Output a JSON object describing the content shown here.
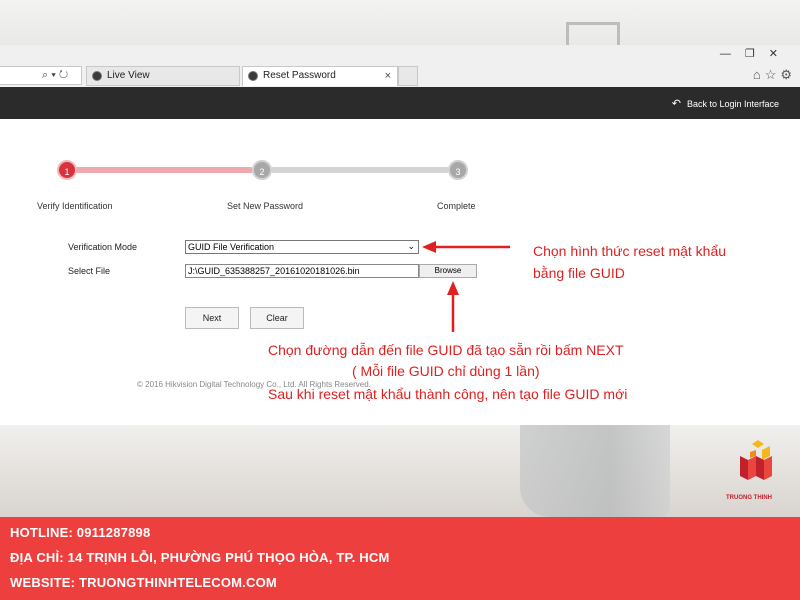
{
  "browser": {
    "tabs": [
      {
        "label": "Live View"
      },
      {
        "label": "Reset Password"
      }
    ],
    "address_controls": "⌕ ▾ ↻"
  },
  "header": {
    "back_link": "Back to Login Interface"
  },
  "steps": [
    {
      "number": "1",
      "label": "Verify Identification",
      "state": "active"
    },
    {
      "number": "2",
      "label": "Set New Password",
      "state": "pending"
    },
    {
      "number": "3",
      "label": "Complete",
      "state": "pending"
    }
  ],
  "form": {
    "mode_label": "Verification Mode",
    "mode_value": "GUID File Verification",
    "file_label": "Select File",
    "file_value": "J:\\GUID_635388257_20161020181026.bin",
    "browse_label": "Browse",
    "next_label": "Next",
    "clear_label": "Clear"
  },
  "copyright": "© 2016 Hikvision Digital Technology Co., Ltd. All Rights Reserved.",
  "annotations": {
    "mode_note_line1": "Chọn hình thức reset mật khẩu",
    "mode_note_line2": "bằng file GUID",
    "file_note_line1": "Chọn đường dẫn đến file GUID đã tạo sẵn rồi bấm NEXT",
    "file_note_line2": "( Mỗi file GUID chỉ dùng 1 lần)",
    "file_note_line3": "Sau khi reset mật khẩu thành công, nên tạo file GUID mới"
  },
  "brand": {
    "logo_text": "TRUONG THINH"
  },
  "footer": {
    "hotline": "HOTLINE: 0911287898",
    "address": "ĐỊA CHỈ: 14 TRỊNH LỖI, PHƯỜNG PHÚ THỌO HÒA, TP. HCM",
    "website": "WEBSITE: TRUONGTHINHTELECOM.COM"
  },
  "colors": {
    "accent_red": "#e02020",
    "step_active": "#d9323f",
    "footer_red": "#ee3f3f"
  }
}
